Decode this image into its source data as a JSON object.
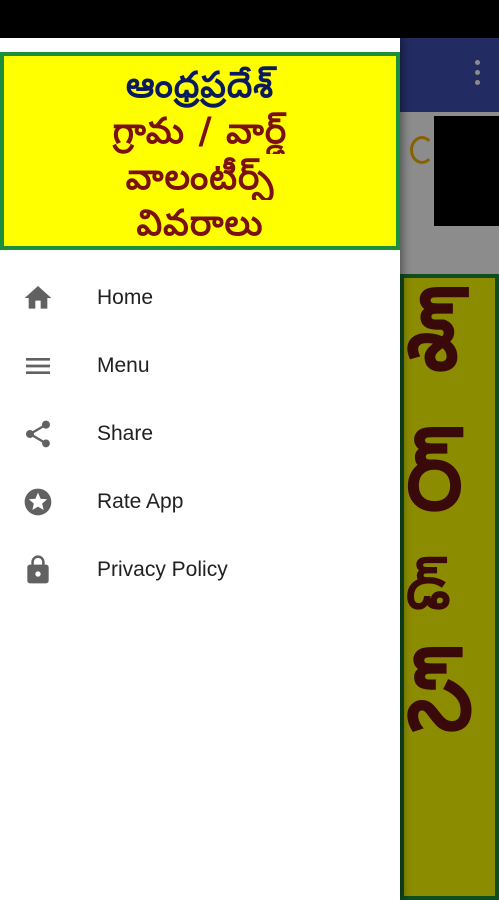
{
  "header": {
    "title_lines": [
      "ఆంధ్రప్రదేశ్",
      "గ్రామ / వార్డ్",
      "వాలంటీర్స్",
      "వివరాలు"
    ]
  },
  "menu": {
    "items": [
      {
        "label": "Home",
        "icon": "home-icon"
      },
      {
        "label": "Menu",
        "icon": "menu-icon"
      },
      {
        "label": "Share",
        "icon": "share-icon"
      },
      {
        "label": "Rate App",
        "icon": "star-icon"
      },
      {
        "label": "Privacy Policy",
        "icon": "lock-icon"
      }
    ]
  },
  "background": {
    "banner_glyphs": [
      "శ్",
      "ర్",
      "డ్",
      "స్"
    ]
  },
  "colors": {
    "toolbar": "#3f51b5",
    "banner_bg": "#ffff00",
    "banner_border": "#1b8f3a",
    "icon": "#616161"
  }
}
